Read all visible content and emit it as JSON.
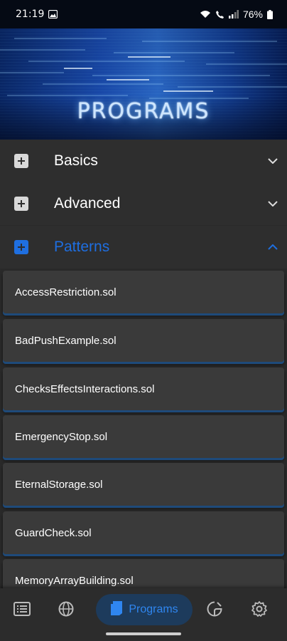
{
  "status_bar": {
    "time": "21:19",
    "battery": "76%",
    "icons": [
      "gallery-icon",
      "wifi-icon",
      "call-icon",
      "signal-icon",
      "battery-icon"
    ]
  },
  "hero": {
    "title": "PROGRAMS"
  },
  "sections": [
    {
      "label": "Basics",
      "expanded": false
    },
    {
      "label": "Advanced",
      "expanded": false
    },
    {
      "label": "Patterns",
      "expanded": true
    }
  ],
  "files": [
    "AccessRestriction.sol",
    "BadPushExample.sol",
    "ChecksEffectsInteractions.sol",
    "EmergencyStop.sol",
    "EternalStorage.sol",
    "GuardCheck.sol",
    "MemoryArrayBuilding.sol"
  ],
  "bottom_nav": {
    "items": [
      "list-icon",
      "globe-icon",
      "programs-icon",
      "note-icon",
      "settings-icon"
    ],
    "active_label": "Programs"
  },
  "colors": {
    "accent": "#1e6ee0",
    "background": "#2e2e2e",
    "card": "#3a3a3a"
  }
}
